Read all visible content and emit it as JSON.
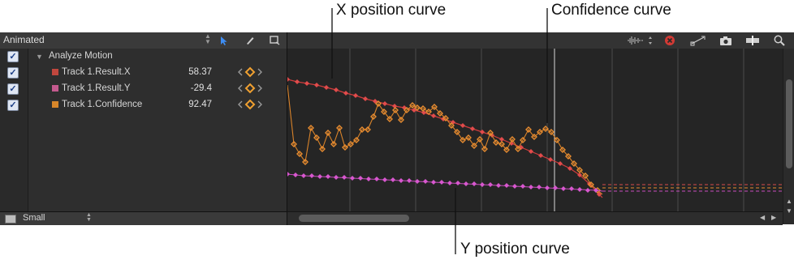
{
  "header": {
    "animated_select": "Animated",
    "tools": [
      "pointer-tool",
      "pen-tool",
      "frame-tool"
    ],
    "right_tools": [
      "audio-waveform-button",
      "clear-button",
      "transform-button",
      "snapshot-button",
      "split-button",
      "zoom-button"
    ]
  },
  "rows": [
    {
      "label": "Analyze Motion",
      "value": "",
      "checked": true,
      "color": ""
    },
    {
      "label": "Track 1.Result.X",
      "value": "58.37",
      "checked": true,
      "color": "#c0473e"
    },
    {
      "label": "Track 1.Result.Y",
      "value": "-29.4",
      "checked": true,
      "color": "#c45a8e"
    },
    {
      "label": "Track 1.Confidence",
      "value": "92.47",
      "checked": true,
      "color": "#d7862a"
    }
  ],
  "footer": {
    "size_select": "Small"
  },
  "colors": {
    "x_curve": "#e04848",
    "y_curve": "#d253c8",
    "confidence_curve": "#e88c30",
    "keyframe_accent": "#f0a030"
  },
  "callouts": {
    "x_curve": "X position curve",
    "confidence_curve": "Confidence curve",
    "y_curve": "Y position curve"
  }
}
